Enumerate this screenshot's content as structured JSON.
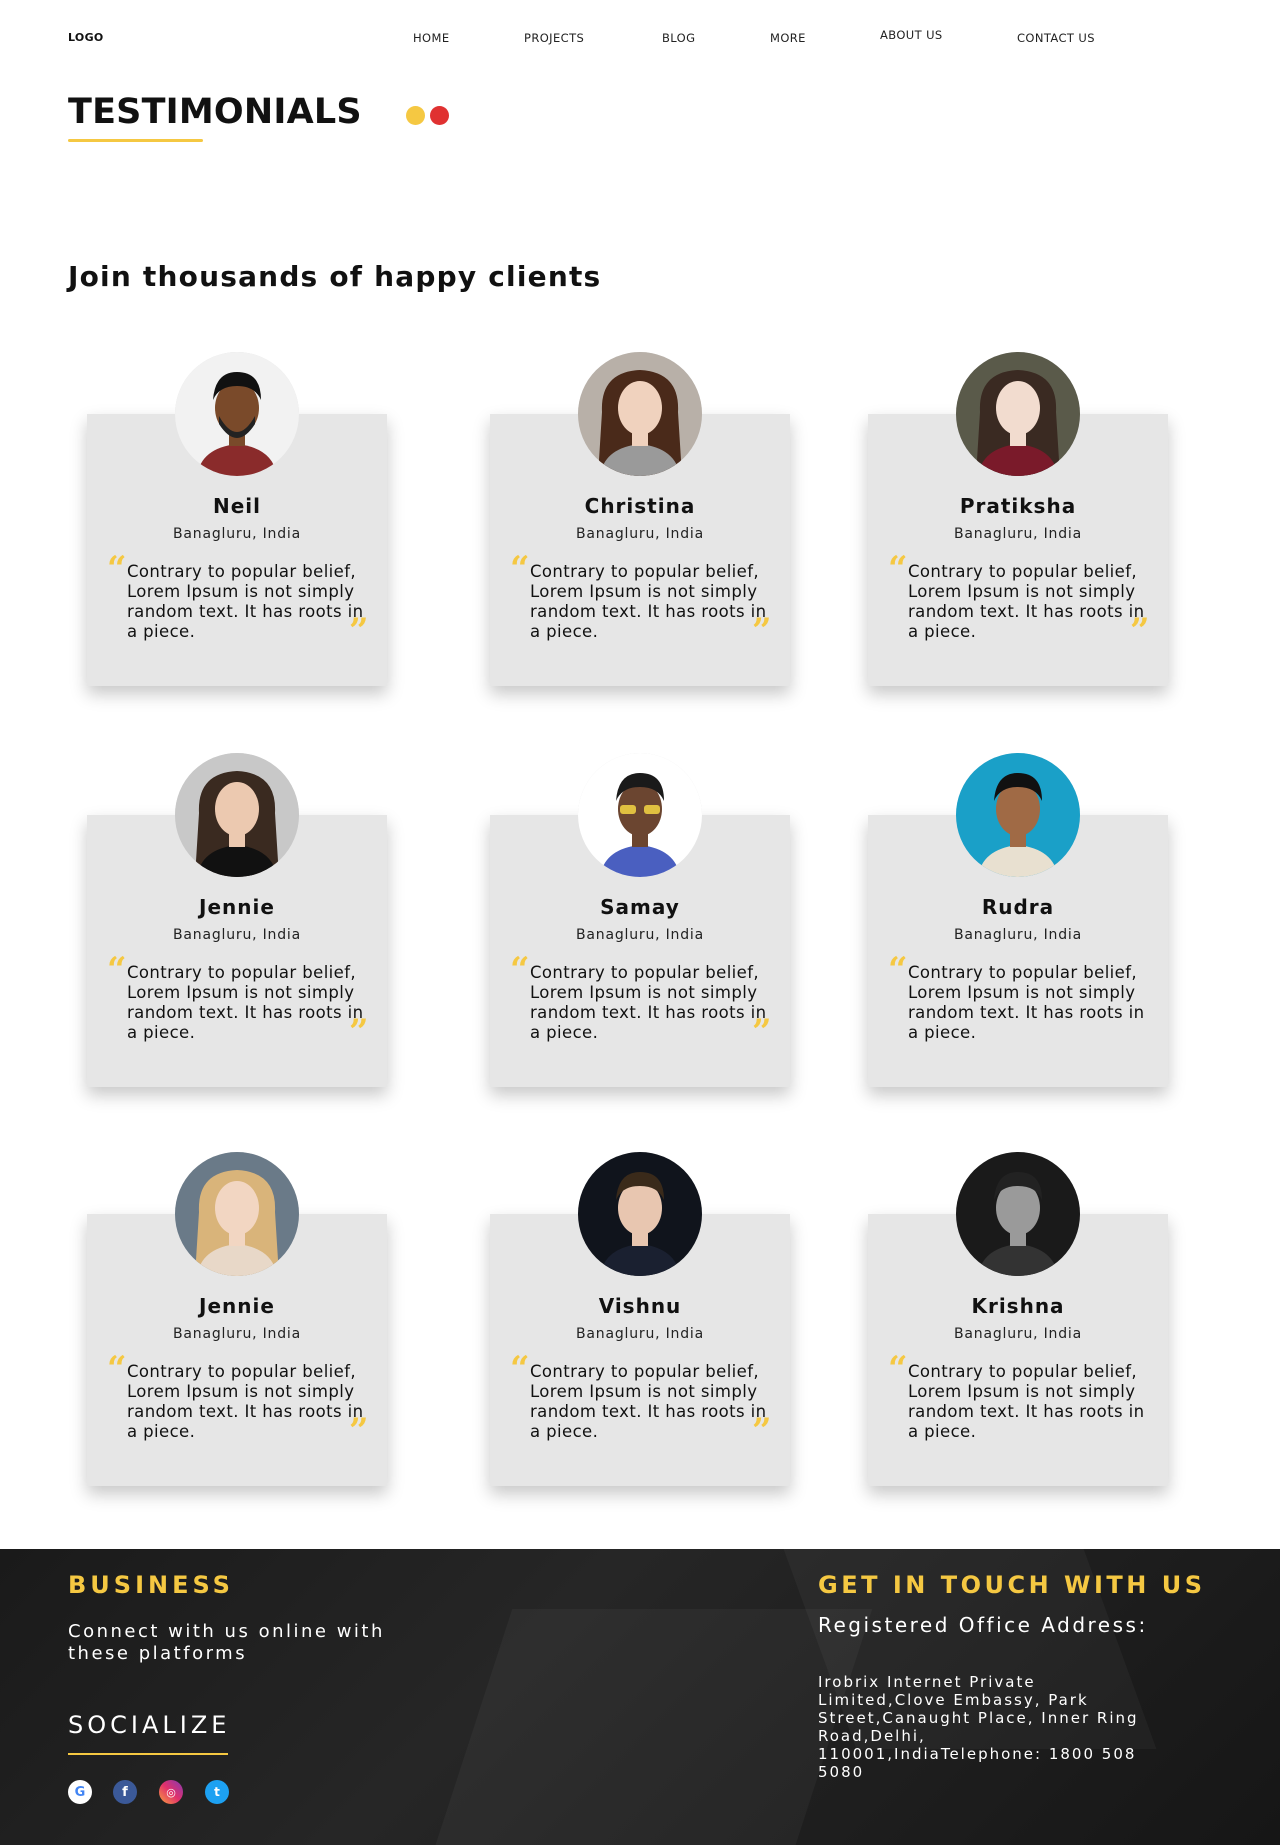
{
  "nav": {
    "logo": "LOGO",
    "items": [
      "HOME",
      "PROJECTS",
      "BLOG",
      "MORE",
      "ABOUT US",
      "CONTACT US"
    ]
  },
  "header": {
    "title": "TESTIMONIALS",
    "subtitle": "Join thousands of happy clients"
  },
  "testimonials": [
    {
      "name": "Neil",
      "location": "Banagluru, India",
      "quote": "Contrary to popular belief, Lorem Ipsum is not simply random text. It has roots in a piece.",
      "show_close_quote": true
    },
    {
      "name": "Christina",
      "location": "Banagluru, India",
      "quote": "Contrary to popular belief, Lorem Ipsum is not simply random text. It has roots in a piece.",
      "show_close_quote": true
    },
    {
      "name": "Pratiksha",
      "location": "Banagluru, India",
      "quote": "Contrary to popular belief, Lorem Ipsum is not simply random text. It has roots in a piece.",
      "show_close_quote": true
    },
    {
      "name": "Jennie",
      "location": "Banagluru, India",
      "quote": "Contrary to popular belief, Lorem Ipsum is not simply random text. It has roots in a piece.",
      "show_close_quote": true
    },
    {
      "name": "Samay",
      "location": "Banagluru, India",
      "quote": "Contrary to popular belief, Lorem Ipsum is not simply random text. It has roots in a piece.",
      "show_close_quote": true
    },
    {
      "name": "Rudra",
      "location": "Banagluru, India",
      "quote": "Contrary to popular belief, Lorem Ipsum is not simply random text. It has roots in a piece.",
      "show_close_quote": false
    },
    {
      "name": "Jennie",
      "location": "Banagluru, India",
      "quote": "Contrary to popular belief, Lorem Ipsum is not simply random text. It has roots in a piece.",
      "show_close_quote": true
    },
    {
      "name": "Vishnu",
      "location": "Banagluru, India",
      "quote": "Contrary to popular belief, Lorem Ipsum is not simply random text. It has roots in a piece.",
      "show_close_quote": true
    },
    {
      "name": "Krishna",
      "location": "Banagluru, India",
      "quote": "Contrary to popular belief, Lorem Ipsum is not simply random text. It has roots in a piece.",
      "show_close_quote": false
    }
  ],
  "footer": {
    "business_title": "BUSINESS",
    "connect_text": "Connect with us online with these platforms",
    "socialize_title": "SOCIALIZE",
    "social_icons": [
      "google-icon",
      "facebook-icon",
      "instagram-icon",
      "twitter-icon"
    ],
    "touch_title": "GET IN TOUCH WITH US",
    "registered_label": "Registered Office Address:",
    "address": "Irobrix Internet Private Limited,Clove Embassy, Park Street,Canaught Place, Inner Ring Road,Delhi, 110001,IndiaTelephone: 1800 508 5080"
  },
  "colors": {
    "accent_yellow": "#f5c842",
    "accent_red": "#e03131",
    "card_bg": "#e6e6e6",
    "footer_bg": "#1e1e1e"
  }
}
